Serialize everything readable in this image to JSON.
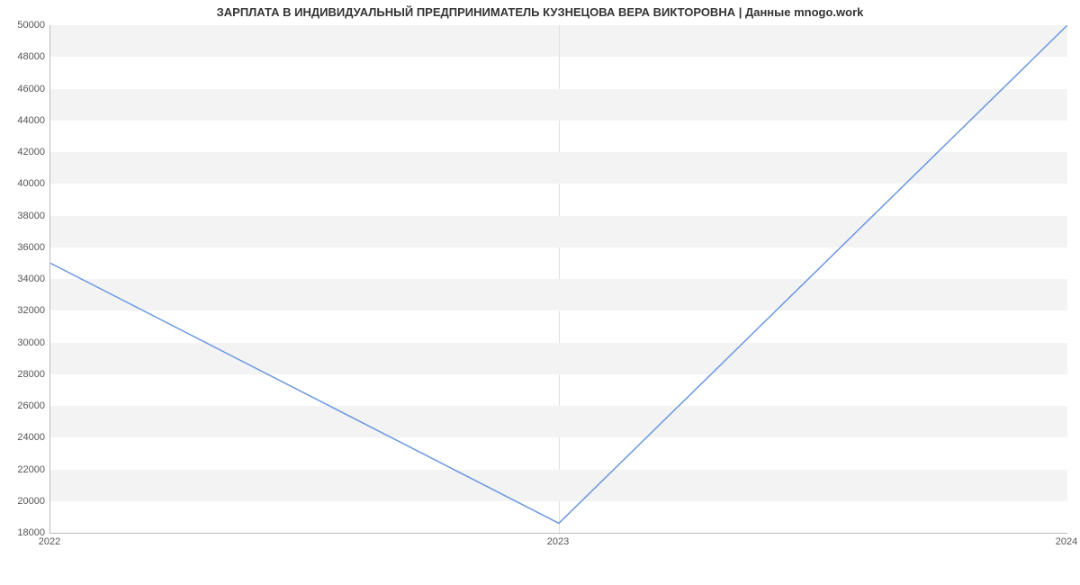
{
  "chart_data": {
    "type": "line",
    "title": "ЗАРПЛАТА В ИНДИВИДУАЛЬНЫЙ ПРЕДПРИНИМАТЕЛЬ КУЗНЕЦОВА ВЕРА ВИКТОРОВНА | Данные mnogo.work",
    "xlabel": "",
    "ylabel": "",
    "x": [
      "2022",
      "2023",
      "2024"
    ],
    "values": [
      35000,
      18600,
      50000
    ],
    "x_ticks": [
      "2022",
      "2023",
      "2024"
    ],
    "y_ticks": [
      18000,
      20000,
      22000,
      24000,
      26000,
      28000,
      30000,
      32000,
      34000,
      36000,
      38000,
      40000,
      42000,
      44000,
      46000,
      48000,
      50000
    ],
    "ylim": [
      18000,
      50000
    ],
    "band_stripes": true
  },
  "colors": {
    "line": "#6b98e0",
    "band": "#f3f3f3"
  }
}
